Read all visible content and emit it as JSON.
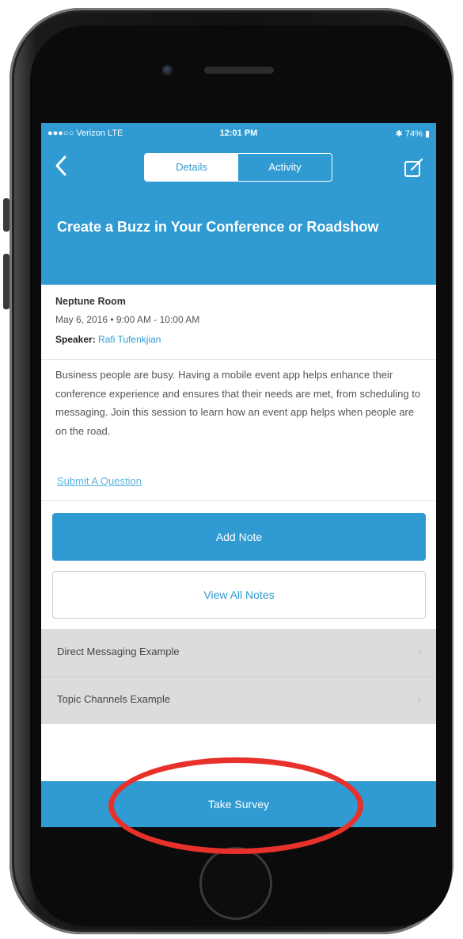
{
  "status_bar": {
    "carrier": "●●●○○ Verizon  LTE",
    "time": "12:01 PM",
    "battery": "74%"
  },
  "nav": {
    "back_icon": "chevron-left-icon",
    "tabs": [
      {
        "label": "Details",
        "active": true
      },
      {
        "label": "Activity",
        "active": false
      }
    ],
    "compose_icon": "compose-icon"
  },
  "session": {
    "title": "Create a Buzz in Your Conference or Roadshow",
    "room": "Neptune Room",
    "datetime": "May 6, 2016  •  9:00 AM - 10:00 AM",
    "speaker_label": "Speaker:",
    "speaker_name": "Rafi Tufenkjian",
    "description": "Business people are busy. Having a mobile event app helps enhance their conference experience and ensures that their needs are met, from scheduling to messaging. Join this session to learn how an event app helps when people are on the road.",
    "submit_question": "Submit A Question"
  },
  "notes": {
    "add_label": "Add Note",
    "view_all_label": "View All Notes"
  },
  "links": [
    {
      "label": "Direct Messaging Example"
    },
    {
      "label": "Topic Channels Example"
    }
  ],
  "footer": {
    "survey_label": "Take Survey"
  },
  "colors": {
    "brand_blue": "#2f9bd2",
    "annotation_red": "#e8312a"
  }
}
